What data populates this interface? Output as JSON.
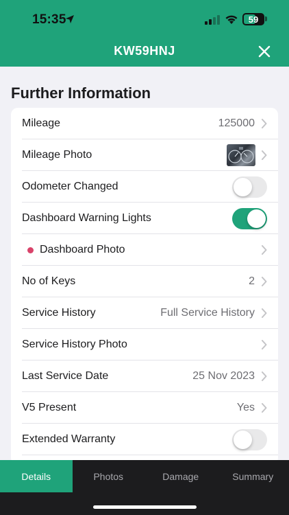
{
  "status_bar": {
    "time": "15:35",
    "battery": "59"
  },
  "header": {
    "title": "KW59HNJ"
  },
  "section": {
    "title": "Further Information"
  },
  "rows": [
    {
      "label": "Mileage",
      "value": "125000"
    },
    {
      "label": "Mileage Photo"
    },
    {
      "label": "Odometer Changed",
      "toggle": false
    },
    {
      "label": "Dashboard Warning Lights",
      "toggle": true
    },
    {
      "label": "Dashboard Photo"
    },
    {
      "label": "No of Keys",
      "value": "2"
    },
    {
      "label": "Service History",
      "value": "Full Service History"
    },
    {
      "label": "Service History Photo"
    },
    {
      "label": "Last Service Date",
      "value": "25 Nov 2023"
    },
    {
      "label": "V5 Present",
      "value": "Yes"
    },
    {
      "label": "Extended Warranty",
      "toggle": false
    }
  ],
  "tabs": [
    {
      "label": "Details",
      "active": true
    },
    {
      "label": "Photos"
    },
    {
      "label": "Damage"
    },
    {
      "label": "Summary"
    }
  ],
  "colors": {
    "accent": "#1fa37a",
    "indicator_dot": "#d9436a",
    "tab_bar": "#1c1c1e"
  }
}
